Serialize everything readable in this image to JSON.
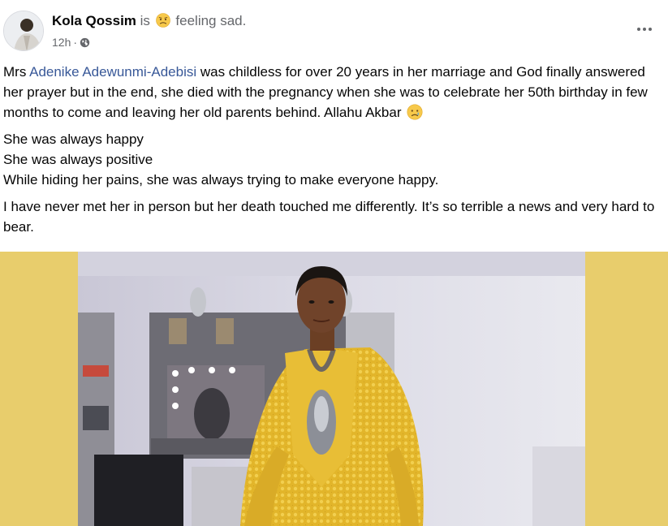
{
  "post": {
    "author": "Kola Qossim",
    "activity_verb": "is",
    "activity": "feeling sad.",
    "timestamp": "12h",
    "separator": "·",
    "privacy_icon": "globe-icon",
    "more_icon": "more-options-icon",
    "paragraph1": {
      "prefix": "Mrs ",
      "mention": "Adenike Adewunmi-Adebisi",
      "text": " was childless for over 20 years in her marriage and God finally answered her prayer but in the end, she died with the pregnancy when she was to celebrate her 50th birthday in few months to come and leaving her old parents behind. Allahu Akbar"
    },
    "paragraph2_lines": [
      "She was always happy",
      "She was always positive",
      "While hiding her pains, she was always trying to make everyone happy."
    ],
    "paragraph3": "I have never met her in person but her death touched me differently. It’s so terrible a news and very hard to bear.",
    "colors": {
      "mention": "#385898",
      "secondary_text": "#65676b",
      "photo_background": "#e8cd6c"
    }
  }
}
